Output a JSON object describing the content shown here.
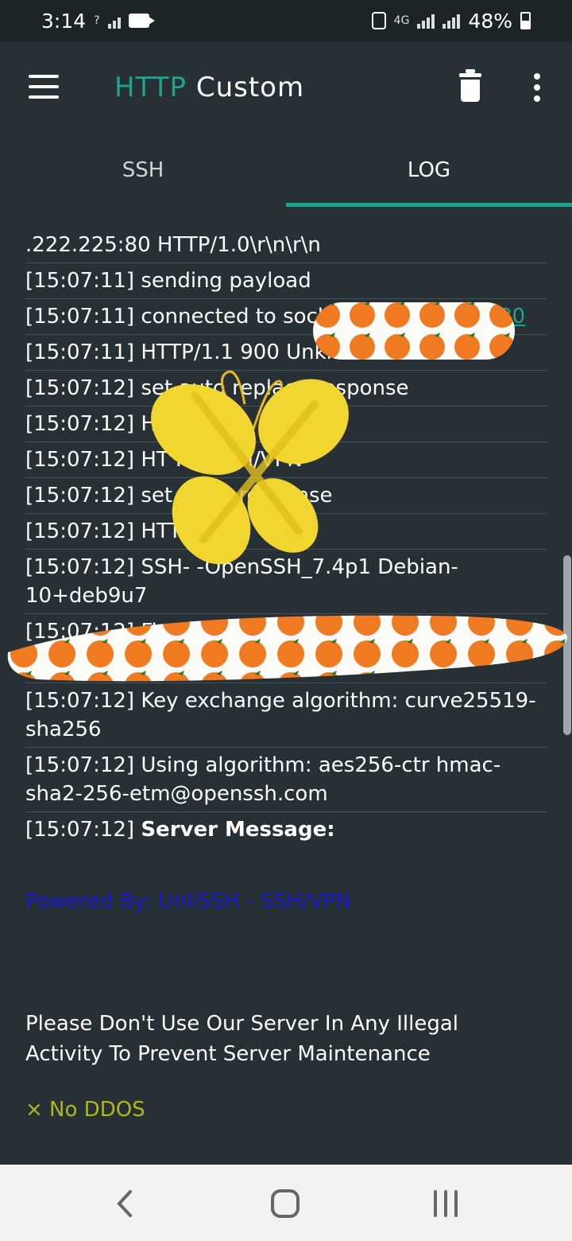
{
  "status_bar": {
    "time": "3:14",
    "network": "4G",
    "battery": "48%"
  },
  "app_bar": {
    "title_accent": "HTTP",
    "title_rest": "Custom",
    "icons": [
      "menu-icon",
      "trash-icon",
      "more-vert-icon"
    ]
  },
  "tabs": [
    {
      "label": "SSH",
      "active": false
    },
    {
      "label": "LOG",
      "active": true
    }
  ],
  "log": [
    ".222.225:80 HTTP/1.0\\r\\n\\r\\n",
    "[15:07:11] sending payload",
    "[15:07:11] connected to sock",
    "[15:07:11] HTTP/1.1 900 Unknown",
    "[15:07:12] set auto replace response",
    "[15:07:12] HT 1 200",
    "[15:07:12] HT H - SSH/VPN",
    "[15:07:12] set aut e response",
    "[15:07:12] HTTP",
    "[15:07:12] SSH- -OpenSSH_7.4p1 Debian-10+deb9u7",
    "[15:07:12] Finger Print",
    "[15:07:12] Key exchange algorithm: curve25519-sha256",
    "[15:07:12] Using algorithm: aes256-ctr hmac-sha2-256-etm@openssh.com"
  ],
  "log_link_fragment": "80",
  "server_message": {
    "time": "[15:07:12]",
    "label": "Server Message:"
  },
  "powered_by": "Powered By: UnliSSH - SSH/VPN",
  "notice": "Please Don't Use Our Server In Any Illegal Activity To Prevent Server Maintenance",
  "no_ddos": "× No DDOS",
  "colors": {
    "accent": "#1fa38f",
    "background": "#263035",
    "powered": "#1a1ad0",
    "warning": "#b0b820"
  }
}
